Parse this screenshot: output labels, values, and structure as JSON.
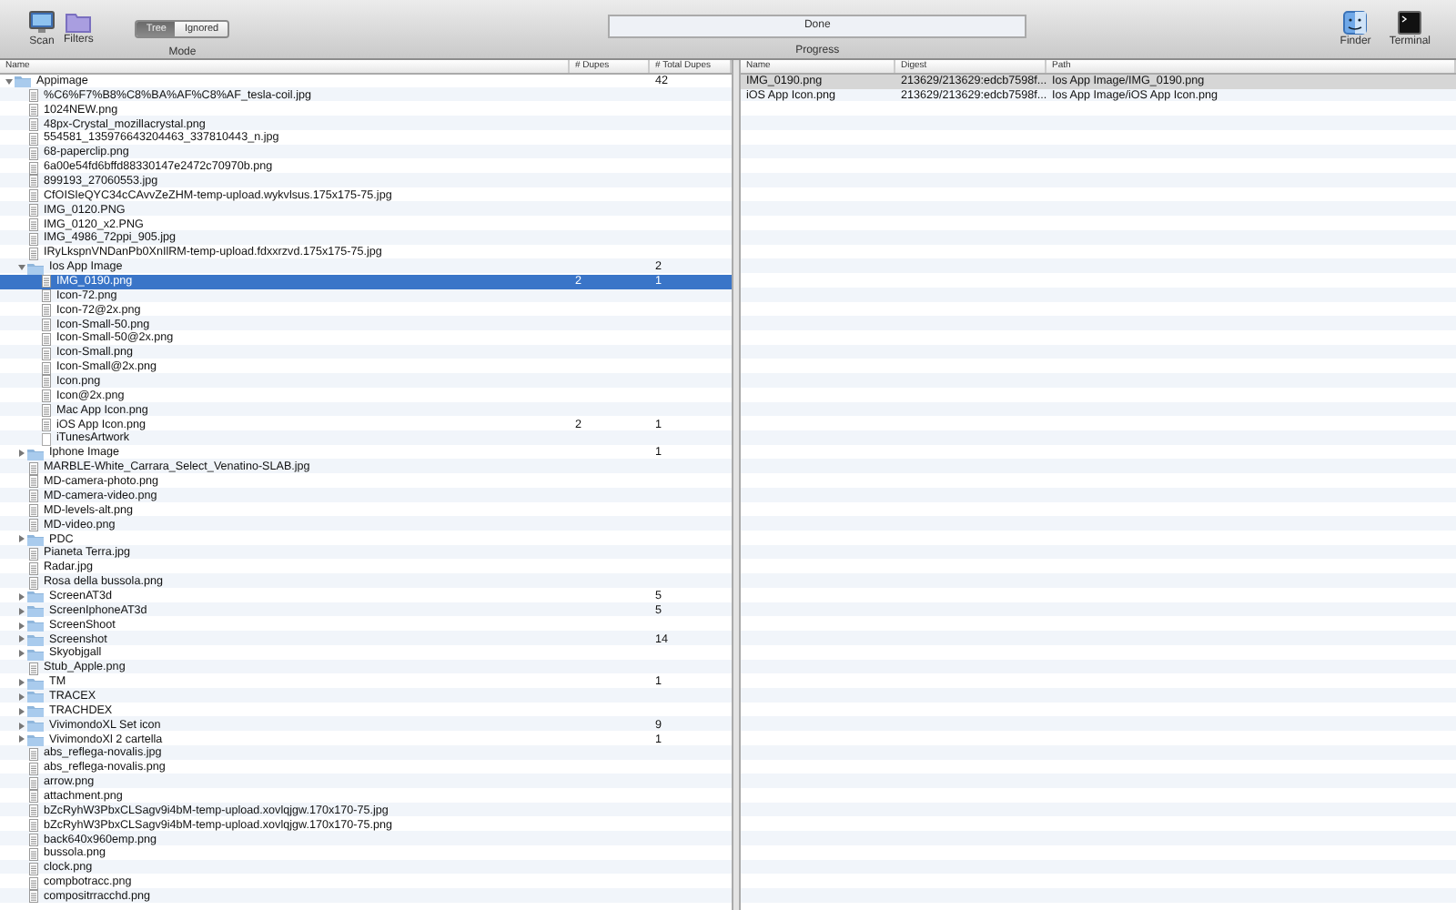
{
  "toolbar": {
    "left_buttons": [
      {
        "kind": "scan",
        "label": "Scan"
      },
      {
        "kind": "filters",
        "label": "Filters"
      }
    ],
    "mode": {
      "label": "Mode",
      "segments": [
        {
          "label": "Tree",
          "selected": true
        },
        {
          "label": "Ignored",
          "selected": false
        }
      ]
    },
    "progress": {
      "status": "Done",
      "label": "Progress"
    },
    "right_buttons": [
      {
        "kind": "finder",
        "label": "Finder"
      },
      {
        "kind": "terminal",
        "label": "Terminal"
      }
    ]
  },
  "tree": {
    "columns": [
      "Name",
      "# Dupes",
      "# Total Dupes"
    ],
    "items": [
      {
        "kind": "folder",
        "name": "Appimage",
        "total_dupes": "42",
        "expanded": true,
        "selected": false,
        "children": [
          {
            "kind": "file",
            "name": "%C6%F7%B8%C8%BA%AF%C8%AF_tesla-coil.jpg",
            "selected": false
          },
          {
            "kind": "file",
            "name": "1024NEW.png",
            "selected": false
          },
          {
            "kind": "file",
            "name": "48px-Crystal_mozillacrystal.png",
            "selected": false
          },
          {
            "kind": "file",
            "name": "554581_135976643204463_337810443_n.jpg",
            "selected": false
          },
          {
            "kind": "file",
            "name": "68-paperclip.png",
            "selected": false
          },
          {
            "kind": "file",
            "name": "6a00e54fd6bffd88330147e2472c70970b.png",
            "selected": false
          },
          {
            "kind": "file",
            "name": "899193_27060553.jpg",
            "selected": false
          },
          {
            "kind": "file",
            "name": "CfOISIeQYC34cCAvvZeZHM-temp-upload.wykvlsus.175x175-75.jpg",
            "selected": false
          },
          {
            "kind": "file",
            "name": "IMG_0120.PNG",
            "selected": false
          },
          {
            "kind": "file",
            "name": "IMG_0120_x2.PNG",
            "selected": false
          },
          {
            "kind": "file",
            "name": "IMG_4986_72ppi_905.jpg",
            "selected": false
          },
          {
            "kind": "file",
            "name": "IRyLkspnVNDanPb0XnIlRM-temp-upload.fdxxrzvd.175x175-75.jpg",
            "selected": false
          },
          {
            "kind": "folder",
            "name": "Ios App Image",
            "total_dupes": "2",
            "expanded": true,
            "selected": false,
            "children": [
              {
                "kind": "file",
                "name": "IMG_0190.png",
                "dupes": "2",
                "total_dupes": "1",
                "selected": true
              },
              {
                "kind": "file",
                "name": "Icon-72.png",
                "selected": false
              },
              {
                "kind": "file",
                "name": "Icon-72@2x.png",
                "selected": false
              },
              {
                "kind": "file",
                "name": "Icon-Small-50.png",
                "selected": false
              },
              {
                "kind": "file",
                "name": "Icon-Small-50@2x.png",
                "selected": false
              },
              {
                "kind": "file",
                "name": "Icon-Small.png",
                "selected": false
              },
              {
                "kind": "file",
                "name": "Icon-Small@2x.png",
                "selected": false
              },
              {
                "kind": "file",
                "name": "Icon.png",
                "selected": false
              },
              {
                "kind": "file",
                "name": "Icon@2x.png",
                "selected": false
              },
              {
                "kind": "file",
                "name": "Mac App Icon.png",
                "selected": false
              },
              {
                "kind": "file",
                "name": "iOS App Icon.png",
                "dupes": "2",
                "total_dupes": "1",
                "selected": false
              },
              {
                "kind": "blank",
                "name": "iTunesArtwork",
                "selected": false
              }
            ]
          },
          {
            "kind": "folder",
            "name": "Iphone Image",
            "total_dupes": "1",
            "expanded": false,
            "selected": false
          },
          {
            "kind": "file",
            "name": "MARBLE-White_Carrara_Select_Venatino-SLAB.jpg",
            "selected": false
          },
          {
            "kind": "file",
            "name": "MD-camera-photo.png",
            "selected": false
          },
          {
            "kind": "file",
            "name": "MD-camera-video.png",
            "selected": false
          },
          {
            "kind": "file",
            "name": "MD-levels-alt.png",
            "selected": false
          },
          {
            "kind": "file",
            "name": "MD-video.png",
            "selected": false
          },
          {
            "kind": "folder",
            "name": "PDC",
            "expanded": false,
            "selected": false
          },
          {
            "kind": "file",
            "name": "Pianeta Terra.jpg",
            "selected": false
          },
          {
            "kind": "file",
            "name": "Radar.jpg",
            "selected": false
          },
          {
            "kind": "file",
            "name": "Rosa della bussola.png",
            "selected": false
          },
          {
            "kind": "folder",
            "name": "ScreenAT3d",
            "total_dupes": "5",
            "expanded": false,
            "selected": false
          },
          {
            "kind": "folder",
            "name": "ScreenIphoneAT3d",
            "total_dupes": "5",
            "expanded": false,
            "selected": false
          },
          {
            "kind": "folder",
            "name": "ScreenShoot",
            "expanded": false,
            "selected": false
          },
          {
            "kind": "folder",
            "name": "Screenshot",
            "total_dupes": "14",
            "expanded": false,
            "selected": false
          },
          {
            "kind": "folder",
            "name": "Skyobjgall",
            "expanded": false,
            "selected": false
          },
          {
            "kind": "file",
            "name": "Stub_Apple.png",
            "selected": false
          },
          {
            "kind": "folder",
            "name": "TM",
            "total_dupes": "1",
            "expanded": false,
            "selected": false
          },
          {
            "kind": "folder",
            "name": "TRACEX",
            "expanded": false,
            "selected": false
          },
          {
            "kind": "folder",
            "name": "TRACHDEX",
            "expanded": false,
            "selected": false
          },
          {
            "kind": "folder",
            "name": "VivimondoXL Set icon",
            "total_dupes": "9",
            "expanded": false,
            "selected": false
          },
          {
            "kind": "folder",
            "name": "VivimondoXl 2 cartella",
            "total_dupes": "1",
            "expanded": false,
            "selected": false
          },
          {
            "kind": "file",
            "name": "abs_reflega-novalis.jpg",
            "selected": false
          },
          {
            "kind": "file",
            "name": "abs_reflega-novalis.png",
            "selected": false
          },
          {
            "kind": "file",
            "name": "arrow.png",
            "selected": false
          },
          {
            "kind": "file",
            "name": "attachment.png",
            "selected": false
          },
          {
            "kind": "file",
            "name": "bZcRyhW3PbxCLSagv9i4bM-temp-upload.xovlqjgw.170x170-75.jpg",
            "selected": false
          },
          {
            "kind": "file",
            "name": "bZcRyhW3PbxCLSagv9i4bM-temp-upload.xovlqjgw.170x170-75.png",
            "selected": false
          },
          {
            "kind": "file",
            "name": "back640x960emp.png",
            "selected": false
          },
          {
            "kind": "file",
            "name": "bussola.png",
            "selected": false
          },
          {
            "kind": "file",
            "name": "clock.png",
            "selected": false
          },
          {
            "kind": "file",
            "name": "compbotracc.png",
            "selected": false
          },
          {
            "kind": "file",
            "name": "compositrracchd.png",
            "selected": false
          }
        ]
      }
    ]
  },
  "duplicates": {
    "columns": [
      "Name",
      "Digest",
      "Path"
    ],
    "rows": [
      {
        "name": "IMG_0190.png",
        "digest": "213629/213629:edcb7598f...",
        "path": "Ios App Image/IMG_0190.png",
        "selected": true
      },
      {
        "name": "iOS App Icon.png",
        "digest": "213629/213629:edcb7598f...",
        "path": "Ios App Image/iOS App Icon.png",
        "selected": false
      }
    ]
  }
}
